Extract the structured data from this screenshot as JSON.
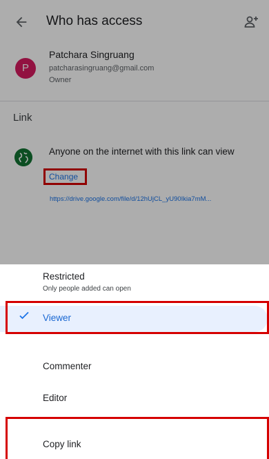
{
  "header": {
    "title": "Who has access",
    "back_icon": "arrow-back-icon",
    "add_icon": "person-add-icon"
  },
  "owner": {
    "initial": "P",
    "name": "Patchara Singruang",
    "email": "patcharasingruang@gmail.com",
    "role": "Owner",
    "avatar_color": "#d81b60"
  },
  "link": {
    "heading": "Link",
    "icon": "globe-icon",
    "icon_color": "#137333",
    "access_text": "Anyone on the internet with this link can view",
    "change_label": "Change",
    "url": "https://drive.google.com/file/d/12hUjCL_yU90Ikia7mM..."
  },
  "sheet": {
    "restricted": {
      "title": "Restricted",
      "description": "Only people added can open"
    },
    "options": {
      "viewer": "Viewer",
      "commenter": "Commenter",
      "editor": "Editor"
    },
    "selected": "Viewer",
    "copy_link": "Copy link"
  },
  "colors": {
    "accent": "#1a73e8",
    "selected_bg": "#e8f0fe",
    "highlight_border": "#d50000"
  }
}
